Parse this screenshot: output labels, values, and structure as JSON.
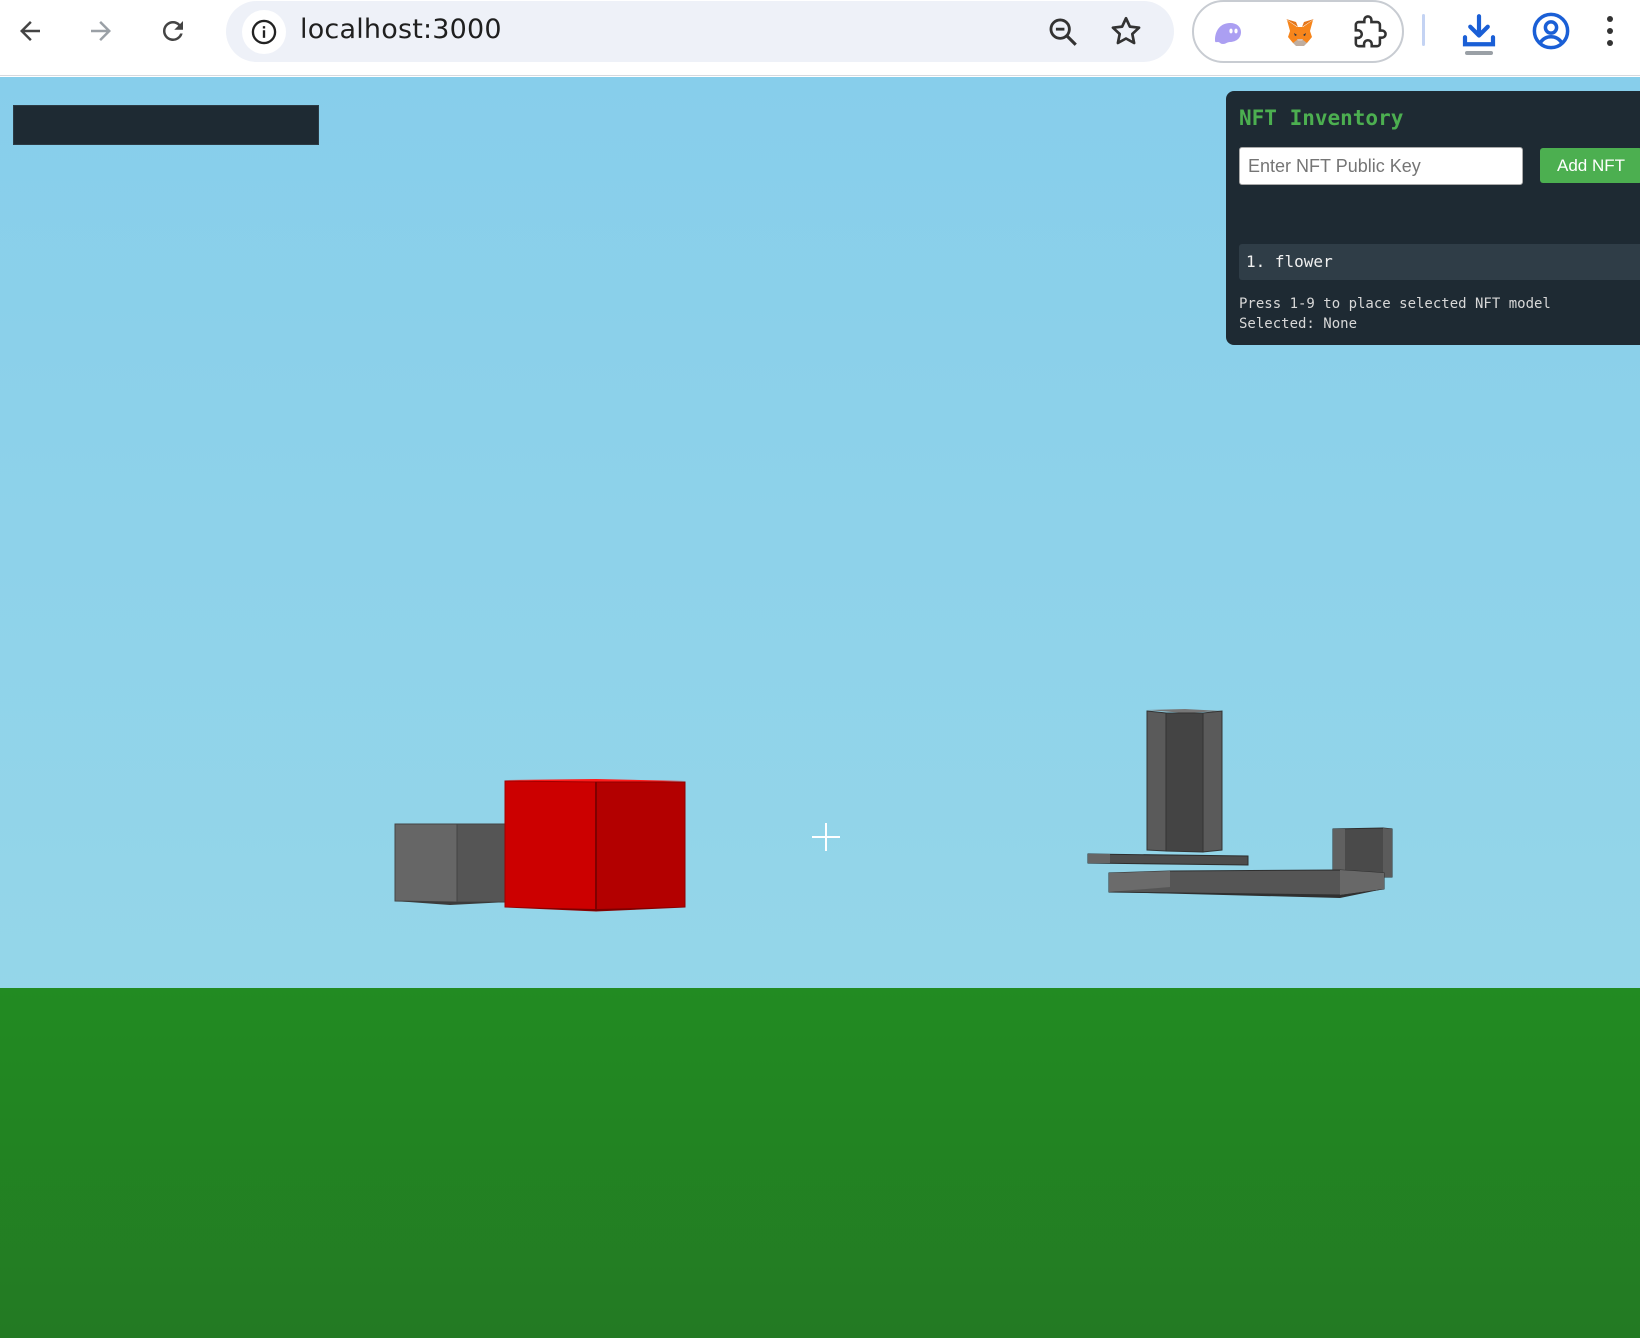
{
  "browser": {
    "url": "localhost:3000",
    "icons": {
      "back": "back-arrow-icon",
      "forward": "forward-arrow-icon",
      "reload": "reload-icon",
      "site_info": "info-icon",
      "zoom": "zoom-out-icon",
      "bookmark": "star-icon",
      "extensions": [
        "phantom-ghost-icon",
        "metamask-fox-icon",
        "puzzle-piece-icon"
      ],
      "download": "download-icon",
      "profile": "account-circle-icon",
      "menu": "kebab-menu-icon"
    }
  },
  "game": {
    "sky_color": "#87ceeb",
    "ground_color": "#228b22",
    "crosshair": "crosshair-icon"
  },
  "nft_panel": {
    "title": "NFT Inventory",
    "input_placeholder": "Enter NFT Public Key",
    "input_value": "",
    "add_button_label": "Add NFT",
    "items": [
      {
        "label": "1. flower"
      }
    ],
    "instructions_line1": "Press 1-9 to place selected NFT model",
    "instructions_line2": "Selected: None",
    "accent_color": "#4caf50"
  }
}
